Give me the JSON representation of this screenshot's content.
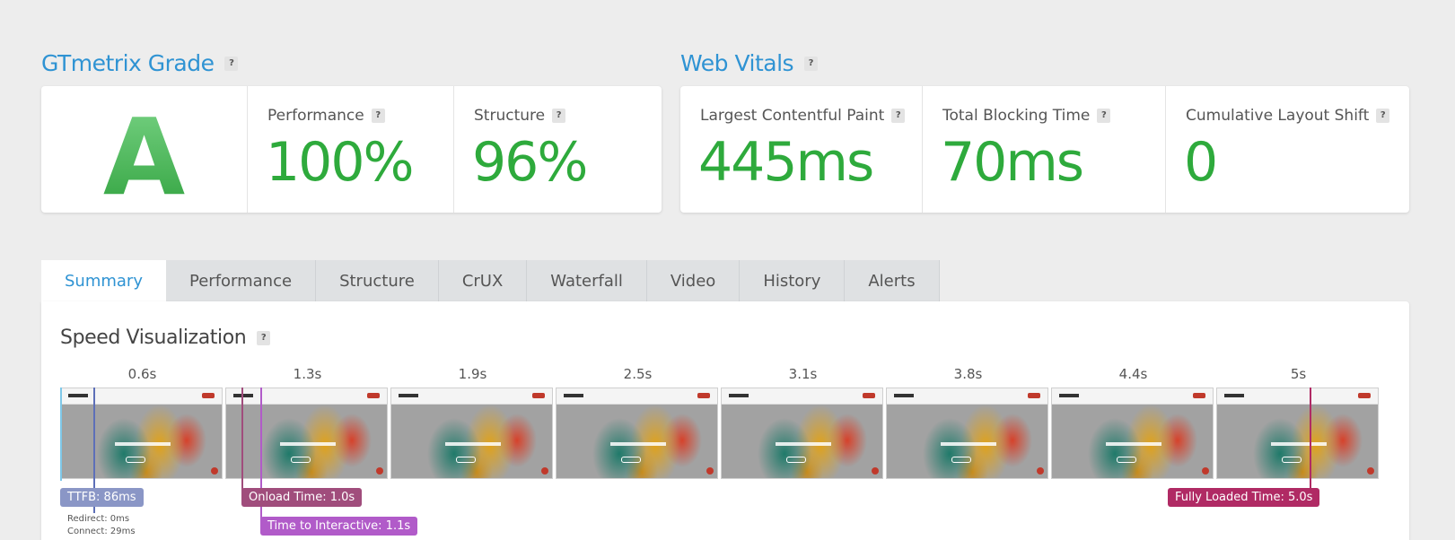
{
  "grade": {
    "title": "GTmetrix Grade",
    "help": "?",
    "letter": "A",
    "performance_label": "Performance",
    "performance_value": "100%",
    "structure_label": "Structure",
    "structure_value": "96%"
  },
  "vitals": {
    "title": "Web Vitals",
    "help": "?",
    "lcp_label": "Largest Contentful Paint",
    "lcp_value": "445ms",
    "tbt_label": "Total Blocking Time",
    "tbt_value": "70ms",
    "cls_label": "Cumulative Layout Shift",
    "cls_value": "0"
  },
  "tabs": [
    {
      "label": "Summary"
    },
    {
      "label": "Performance"
    },
    {
      "label": "Structure"
    },
    {
      "label": "CrUX"
    },
    {
      "label": "Waterfall"
    },
    {
      "label": "Video"
    },
    {
      "label": "History"
    },
    {
      "label": "Alerts"
    }
  ],
  "speed": {
    "title": "Speed Visualization",
    "help": "?",
    "frame_times": [
      "0.6s",
      "1.3s",
      "1.9s",
      "2.5s",
      "3.1s",
      "3.8s",
      "4.4s",
      "5s"
    ],
    "ttfb_label": "TTFB: 86ms",
    "redirect": "Redirect: 0ms",
    "connect": "Connect: 29ms",
    "onload_label": "Onload Time: 1.0s",
    "tti_label": "Time to Interactive: 1.1s",
    "fully_loaded_label": "Fully Loaded Time: 5.0s"
  },
  "colors": {
    "accent": "#2f93d3",
    "good": "#2eaa3c",
    "ttfb": "#8a96c6",
    "onload": "#a04d7c",
    "tti": "#b15bc9",
    "fully_loaded": "#b02a64"
  }
}
